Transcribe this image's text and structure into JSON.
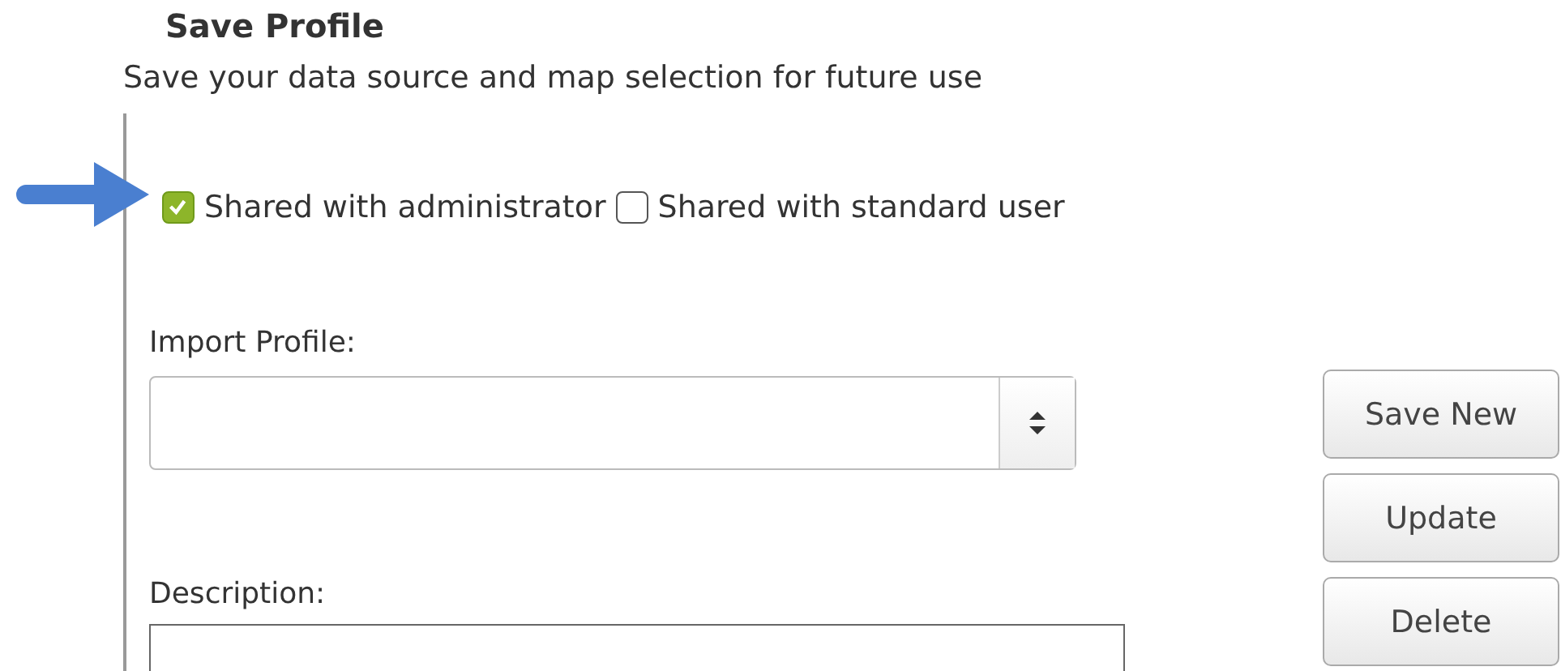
{
  "title": "Save Profile",
  "subtitle": "Save your data source and map selection for future use",
  "share_options": [
    {
      "label": "Shared with administrator",
      "checked": true
    },
    {
      "label": "Shared with standard user",
      "checked": false
    }
  ],
  "import_profile": {
    "label": "Import Profile:"
  },
  "description": {
    "label": "Description:"
  },
  "buttons": [
    "Save New",
    "Update",
    "Delete"
  ]
}
